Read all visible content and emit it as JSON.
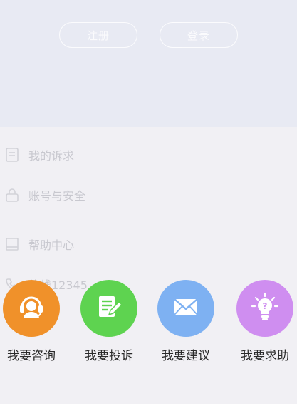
{
  "background": {
    "header": {
      "register_label": "注册",
      "login_label": "登录"
    },
    "menu": [
      {
        "icon": "document-icon",
        "label": "我的诉求"
      },
      {
        "icon": "lock-icon",
        "label": "账号与安全"
      },
      {
        "icon": "book-icon",
        "label": "帮助中心"
      },
      {
        "icon": "phone-icon",
        "label": "热线12345"
      }
    ]
  },
  "share_sheet": {
    "actions": [
      {
        "label": "我要咨询",
        "icon": "customer-service-icon",
        "color": "#f0912a"
      },
      {
        "label": "我要投诉",
        "icon": "edit-document-icon",
        "color": "#5ed350"
      },
      {
        "label": "我要建议",
        "icon": "envelope-icon",
        "color": "#7eb1f2"
      },
      {
        "label": "我要求助",
        "icon": "lightbulb-icon",
        "color": "#cf8ef0"
      }
    ]
  }
}
